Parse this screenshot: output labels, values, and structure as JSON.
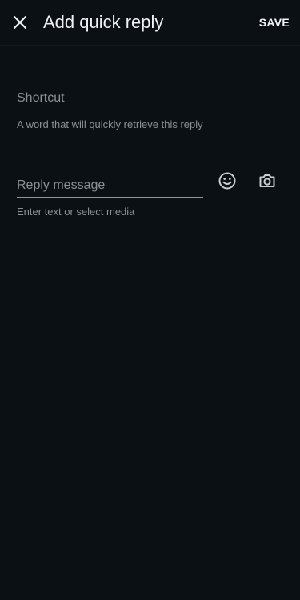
{
  "app_bar": {
    "close_icon": "close-icon",
    "title": "Add quick reply",
    "save_label": "SAVE"
  },
  "shortcut": {
    "placeholder": "Shortcut",
    "value": "",
    "helper": "A word that will quickly retrieve this reply"
  },
  "reply": {
    "placeholder": "Reply message",
    "value": "",
    "helper": "Enter text or select media",
    "emoji_icon": "emoji-icon",
    "camera_icon": "camera-icon"
  },
  "colors": {
    "background": "#0b1014",
    "text_primary": "#eef1f3",
    "text_secondary": "#8a9297",
    "underline": "#8d959a"
  }
}
